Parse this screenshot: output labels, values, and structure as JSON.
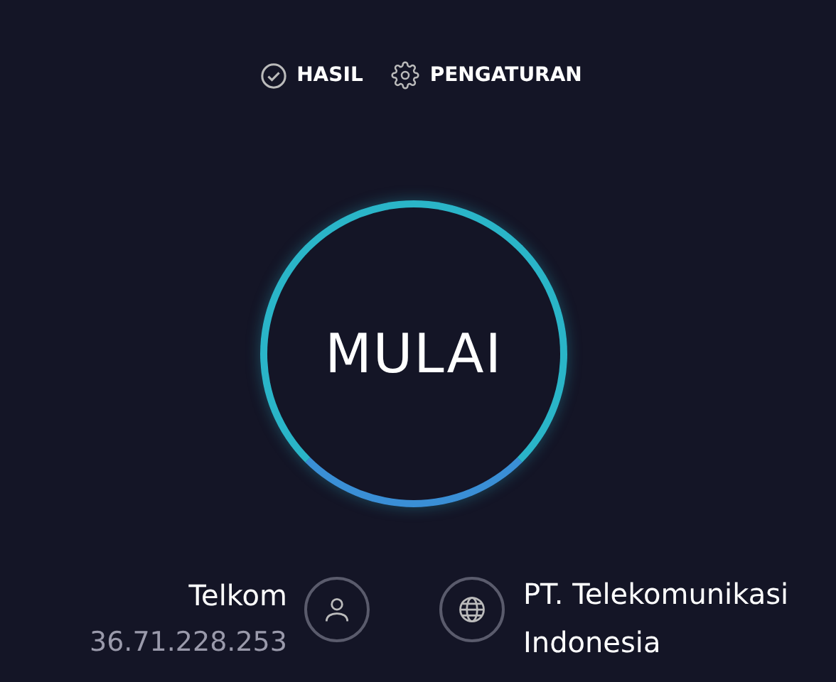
{
  "nav": [
    {
      "label": "HASIL",
      "kind": "results"
    },
    {
      "label": "PENGATURAN",
      "kind": "settings"
    }
  ],
  "start_button": {
    "label": "MULAI"
  },
  "isp": {
    "name": "Telkom",
    "ip": "36.71.228.253"
  },
  "server": {
    "name": "PT. Telekomunikasi Indonesia"
  }
}
